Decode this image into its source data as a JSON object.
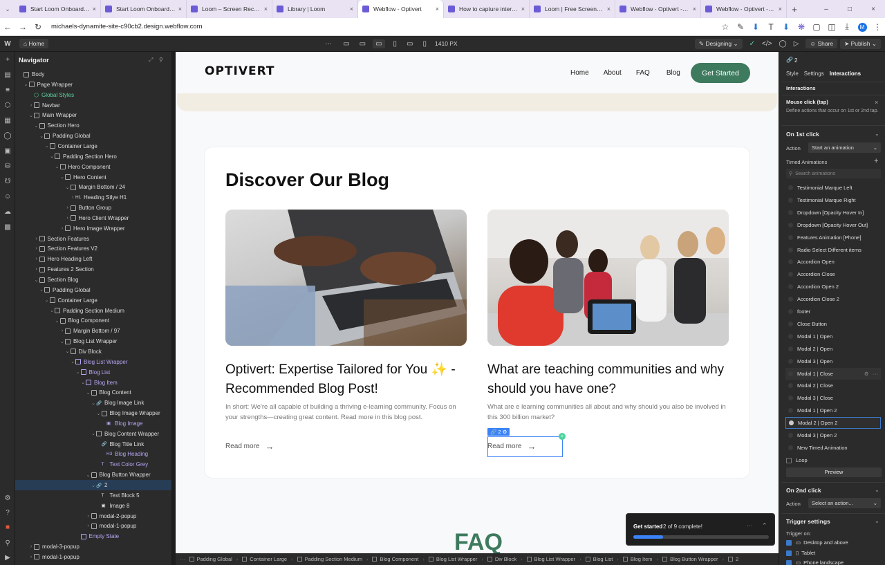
{
  "browser": {
    "tabs": [
      {
        "title": "Start Loom Onboarding",
        "active": false
      },
      {
        "title": "Start Loom Onboarding",
        "active": false
      },
      {
        "title": "Loom – Screen Recorder",
        "active": false
      },
      {
        "title": "Library | Loom",
        "active": false
      },
      {
        "title": "Webflow - Optivert",
        "active": true
      },
      {
        "title": "How to capture internal",
        "active": false
      },
      {
        "title": "Loom | Free Screen & V",
        "active": false
      },
      {
        "title": "Webflow - Optivert - Go",
        "active": false
      },
      {
        "title": "Webflow - Optivert - Go",
        "active": false
      }
    ],
    "new_tab": "+",
    "url": "michaels-dynamite-site-c90cb2.design.webflow.com",
    "profile_letter": "M"
  },
  "toolbar": {
    "page": "Home",
    "width": "1410 PX",
    "mode": "Designing",
    "share": "Share",
    "publish": "Publish"
  },
  "navigator": {
    "title": "Navigator",
    "rows": [
      {
        "label": "Body",
        "depth": 0,
        "caret": "",
        "type": "box"
      },
      {
        "label": "Page Wrapper",
        "depth": 1,
        "caret": "v",
        "type": "box"
      },
      {
        "label": "Global Styles",
        "depth": 2,
        "caret": "",
        "type": "gs"
      },
      {
        "label": "Navbar",
        "depth": 2,
        "caret": ">",
        "type": "box"
      },
      {
        "label": "Main Wrapper",
        "depth": 2,
        "caret": "v",
        "type": "box"
      },
      {
        "label": "Section Hero",
        "depth": 3,
        "caret": "v",
        "type": "box"
      },
      {
        "label": "Padding Global",
        "depth": 4,
        "caret": "v",
        "type": "box"
      },
      {
        "label": "Container Large",
        "depth": 5,
        "caret": "v",
        "type": "box"
      },
      {
        "label": "Padding Section Hero",
        "depth": 6,
        "caret": "v",
        "type": "box"
      },
      {
        "label": "Hero Component",
        "depth": 7,
        "caret": "v",
        "type": "box"
      },
      {
        "label": "Hero Content",
        "depth": 8,
        "caret": "v",
        "type": "box"
      },
      {
        "label": "Margin Bottom / 24",
        "depth": 9,
        "caret": "v",
        "type": "box"
      },
      {
        "label": "Heading Stlye H1",
        "depth": 10,
        "caret": ">",
        "type": "h1"
      },
      {
        "label": "Button Group",
        "depth": 9,
        "caret": ">",
        "type": "box"
      },
      {
        "label": "Hero Client Wrapper",
        "depth": 9,
        "caret": ">",
        "type": "box"
      },
      {
        "label": "Hero Image Wrapper",
        "depth": 8,
        "caret": ">",
        "type": "box"
      },
      {
        "label": "Section Features",
        "depth": 3,
        "caret": ">",
        "type": "box"
      },
      {
        "label": "Section Features V2",
        "depth": 3,
        "caret": ">",
        "type": "box"
      },
      {
        "label": "Hero Heading Left",
        "depth": 3,
        "caret": ">",
        "type": "box"
      },
      {
        "label": "Features 2 Section",
        "depth": 3,
        "caret": ">",
        "type": "box"
      },
      {
        "label": "Section Blog",
        "depth": 3,
        "caret": "v",
        "type": "box"
      },
      {
        "label": "Padding Global",
        "depth": 4,
        "caret": "v",
        "type": "box"
      },
      {
        "label": "Container Large",
        "depth": 5,
        "caret": "v",
        "type": "box"
      },
      {
        "label": "Padding Section Medium",
        "depth": 6,
        "caret": "v",
        "type": "box"
      },
      {
        "label": "Blog Component",
        "depth": 7,
        "caret": "v",
        "type": "box"
      },
      {
        "label": "Margin Bottom / 97",
        "depth": 8,
        "caret": ">",
        "type": "box"
      },
      {
        "label": "Blog List Wrapper",
        "depth": 8,
        "caret": "v",
        "type": "box"
      },
      {
        "label": "Div Block",
        "depth": 9,
        "caret": "v",
        "type": "box"
      },
      {
        "label": "Blog List Wrapper",
        "depth": 10,
        "caret": "v",
        "type": "comp"
      },
      {
        "label": "Blog List",
        "depth": 11,
        "caret": "v",
        "type": "comp"
      },
      {
        "label": "Blog Item",
        "depth": 12,
        "caret": "v",
        "type": "comp"
      },
      {
        "label": "Blog Content",
        "depth": 13,
        "caret": "v",
        "type": "box"
      },
      {
        "label": "Blog Image Link",
        "depth": 14,
        "caret": "v",
        "type": "link"
      },
      {
        "label": "Blog Image Wrapper",
        "depth": 15,
        "caret": "v",
        "type": "box"
      },
      {
        "label": "Blog Image",
        "depth": 16,
        "caret": "",
        "type": "compimg"
      },
      {
        "label": "Blog Content Wrapper",
        "depth": 14,
        "caret": "v",
        "type": "box"
      },
      {
        "label": "Blog Title Link",
        "depth": 15,
        "caret": "",
        "type": "link"
      },
      {
        "label": "Blog Heading",
        "depth": 16,
        "caret": "",
        "type": "comph3"
      },
      {
        "label": "Text Color Grey",
        "depth": 15,
        "caret": "",
        "type": "comptext"
      },
      {
        "label": "Blog Button Wrapper",
        "depth": 13,
        "caret": "v",
        "type": "box"
      },
      {
        "label": "2",
        "depth": 14,
        "caret": "v",
        "type": "link",
        "selected": true
      },
      {
        "label": "Text Block 5",
        "depth": 15,
        "caret": "",
        "type": "text"
      },
      {
        "label": "Image 8",
        "depth": 15,
        "caret": "",
        "type": "img"
      },
      {
        "label": "modal-2-popup",
        "depth": 13,
        "caret": ">",
        "type": "box"
      },
      {
        "label": "modal-1-popup",
        "depth": 13,
        "caret": ">",
        "type": "box"
      },
      {
        "label": "Empty State",
        "depth": 11,
        "caret": "",
        "type": "comp"
      },
      {
        "label": "modal-3-popup",
        "depth": 2,
        "caret": ">",
        "type": "box"
      },
      {
        "label": "modal-1-popup",
        "depth": 2,
        "caret": ">",
        "type": "box"
      }
    ]
  },
  "site": {
    "logo": "OPTIVERT",
    "nav": [
      "Home",
      "About",
      "FAQ",
      "Blog"
    ],
    "cta": "Get Started",
    "blog_heading": "Discover Our Blog",
    "posts": [
      {
        "title": "Optivert: Expertise Tailored for You ✨ - Recommended Blog Post!",
        "excerpt": "In short: We're all capable of building a thriving e-learning community. Focus on your strengths—creating great content. Read more in this blog post.",
        "link": "Read more"
      },
      {
        "title": "What are teaching communities and why should you have one?",
        "excerpt": "What are e learning communities all about and why should you also be involved in this 300 billion market?",
        "link": "Read more"
      }
    ],
    "selected_badge": "2",
    "faq_peek": "FAQ"
  },
  "get_started_widget": {
    "title": "Get started",
    "progress_text": "2 of 9 complete!",
    "progress": 0.22
  },
  "breadcrumbs": [
    "Padding Global",
    "Container Large",
    "Padding Section Medium",
    "Blog Component",
    "Blog List Wrapper",
    "Div Block",
    "Blog List Wrapper",
    "Blog List",
    "Blog Item",
    "Blog Button Wrapper",
    "2"
  ],
  "right_panel": {
    "element_badge": "2",
    "tabs": [
      "Style",
      "Settings",
      "Interactions"
    ],
    "active_tab": "Interactions",
    "section_title": "Interactions",
    "trigger_title": "Mouse click (tap)",
    "trigger_desc": "Define actions that occur on 1st or 2nd tap.",
    "first_click": "On 1st click",
    "action_label": "Action",
    "action_value": "Start an animation",
    "timed_title": "Timed Animations",
    "search_placeholder": "Search animations",
    "animations": [
      "Testimonial Marque Left",
      "Testimonial Marque Right",
      "Dropdown [Opacity Hover In]",
      "Dropdown [Opacity Hover Out]",
      "Features Animation [Phone]",
      "Radio Select Different items",
      "Accordion Open",
      "Accordion Close",
      "Accordion Open 2",
      "Accordion Close 2",
      "footer",
      "Close Button",
      "Modal 1 | Open",
      "Modal 2 | Open",
      "Modal 3 | Open",
      "Modal 1 | Close",
      "Modal 2 | Close",
      "Modal 3 | Close",
      "Modal 1 | Open 2",
      "Modal 2 | Open 2",
      "Modal 3 | Open 2",
      "New Timed Animation"
    ],
    "selected_animation": "Modal 2 | Open 2",
    "loop": "Loop",
    "preview": "Preview",
    "second_click": "On 2nd click",
    "action2_value": "Select an action...",
    "trigger_settings": "Trigger settings",
    "trigger_on": "Trigger on:",
    "devices": [
      "Desktop and above",
      "Tablet",
      "Phone landscape"
    ],
    "accent": "#3c79c8"
  },
  "colors": {
    "brand_green": "#3d7a5e",
    "panel": "#2b2b2b",
    "selection": "#3b82f6"
  }
}
